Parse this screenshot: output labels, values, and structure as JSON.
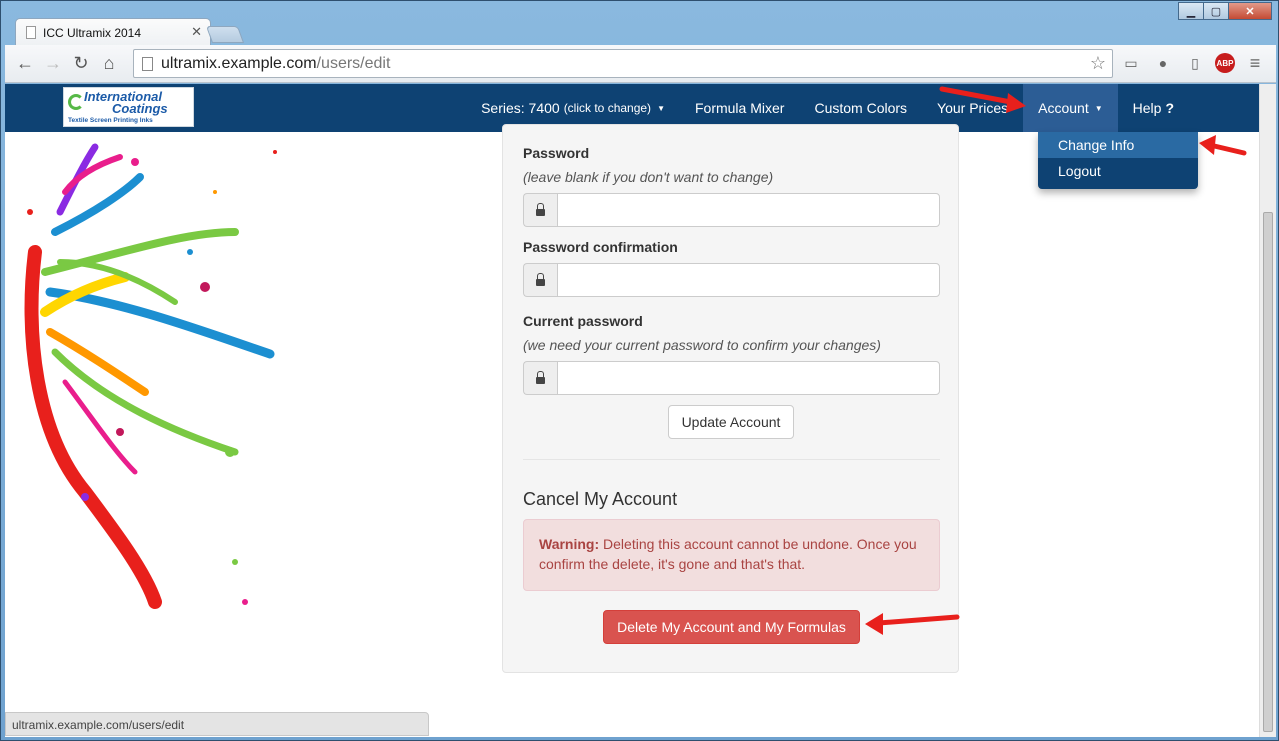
{
  "browser": {
    "tab_title": "ICC Ultramix 2014",
    "url_host": "ultramix.example.com",
    "url_path": "/users/edit",
    "status_url": "ultramix.example.com/users/edit"
  },
  "navbar": {
    "logo_line1": "International",
    "logo_line2": "Coatings",
    "logo_line3": "Textile Screen Printing Inks",
    "series_label": "Series: 7400",
    "series_hint": "(click to change)",
    "items": [
      "Formula Mixer",
      "Custom Colors",
      "Your Prices"
    ],
    "account_label": "Account",
    "help_label": "Help",
    "help_icon": "?",
    "account_menu": [
      "Change Info",
      "Logout"
    ]
  },
  "form": {
    "password_label": "Password",
    "password_hint": "(leave blank if you don't want to change)",
    "password_value": "",
    "password_confirm_label": "Password confirmation",
    "password_confirm_value": "",
    "current_password_label": "Current password",
    "current_password_hint": "(we need your current password to confirm your changes)",
    "current_password_value": "",
    "update_button": "Update Account"
  },
  "cancel": {
    "heading": "Cancel My Account",
    "warning_strong": "Warning:",
    "warning_text": " Deleting this account cannot be undone. Once you confirm the delete, it's gone and that's that.",
    "delete_button": "Delete My Account and My Formulas"
  },
  "colors": {
    "navbar": "#0e4273",
    "danger": "#d9534f",
    "annotation_arrow": "#e8201c"
  }
}
